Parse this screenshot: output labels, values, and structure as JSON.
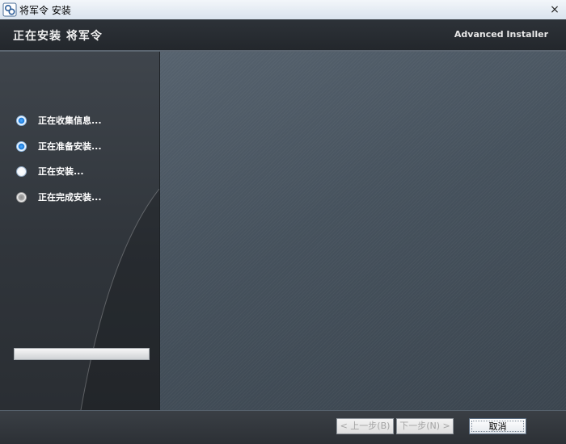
{
  "window": {
    "title": "将军令 安装",
    "close_label": "×"
  },
  "header": {
    "title": "正在安装 将军令",
    "brand": "Advanced Installer"
  },
  "steps": [
    {
      "label": "正在收集信息...",
      "state": "done"
    },
    {
      "label": "正在准备安装...",
      "state": "done"
    },
    {
      "label": "正在安装...",
      "state": "current"
    },
    {
      "label": "正在完成安装...",
      "state": "pending"
    }
  ],
  "progress": {
    "value": 0
  },
  "footer": {
    "back_label": "< 上一步(B)",
    "next_label": "下一步(N) >",
    "cancel_label": "取消"
  },
  "colors": {
    "accent": "#1a78d6",
    "header_bg": "#2d3238",
    "content_bg": "#4a5561"
  }
}
